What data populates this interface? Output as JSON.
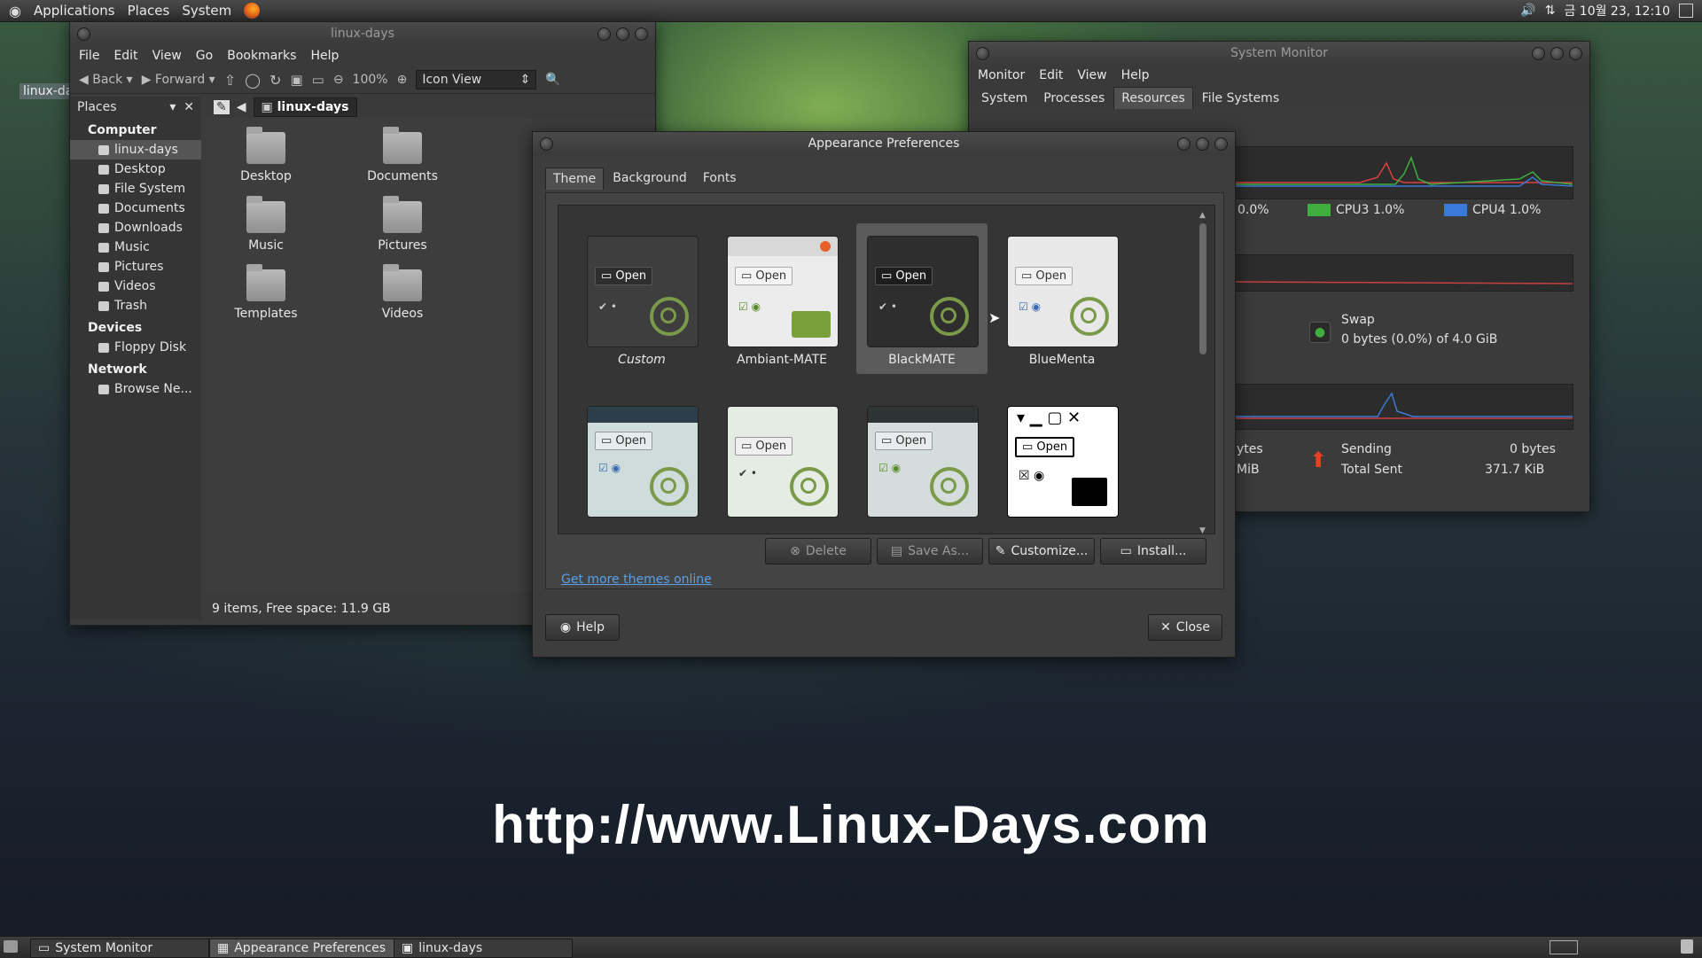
{
  "top_panel": {
    "menus": [
      "Applications",
      "Places",
      "System"
    ],
    "clock": "금 10월 23, 12:10"
  },
  "file_manager": {
    "title": "linux-days",
    "menus": [
      "File",
      "Edit",
      "View",
      "Go",
      "Bookmarks",
      "Help"
    ],
    "toolbar": {
      "back": "Back",
      "forward": "Forward",
      "zoom": "100%",
      "view_mode": "Icon View"
    },
    "sidebar_title": "Places",
    "sections": [
      {
        "label": "Computer",
        "items": [
          "linux-days",
          "Desktop",
          "File System",
          "Documents",
          "Downloads",
          "Music",
          "Pictures",
          "Videos",
          "Trash"
        ]
      },
      {
        "label": "Devices",
        "items": [
          "Floppy Disk"
        ]
      },
      {
        "label": "Network",
        "items": [
          "Browse Ne..."
        ]
      }
    ],
    "path": "linux-days",
    "files": [
      "Desktop",
      "Documents",
      "Music",
      "Pictures",
      "Templates",
      "Videos"
    ],
    "status": "9 items, Free space: 11.9 GB",
    "tab_label": "linux-da"
  },
  "system_monitor": {
    "title": "System Monitor",
    "menus": [
      "Monitor",
      "Edit",
      "View",
      "Help"
    ],
    "tabs": [
      "System",
      "Processes",
      "Resources",
      "File Systems"
    ],
    "cpu": [
      {
        "label": "0.0%"
      },
      {
        "label": "CPU3 1.0%",
        "color": "#3fae3f"
      },
      {
        "label": "CPU4 1.0%",
        "color": "#3a7ad8"
      }
    ],
    "swap": {
      "title": "Swap",
      "value": "0 bytes (0.0%) of 4.0 GiB"
    },
    "net": {
      "recv_partial": "ytes",
      "recv_total_partial": "MiB",
      "sending_label": "Sending",
      "sending_value": "0 bytes",
      "total_sent_label": "Total Sent",
      "total_sent_value": "371.7 KiB"
    }
  },
  "appearance": {
    "title": "Appearance Preferences",
    "tabs": [
      "Theme",
      "Background",
      "Fonts"
    ],
    "themes": [
      "Custom",
      "Ambiant-MATE",
      "BlackMATE",
      "BlueMenta"
    ],
    "open_label": "Open",
    "buttons": {
      "delete": "Delete",
      "save_as": "Save As...",
      "customize": "Customize...",
      "install": "Install..."
    },
    "link": "Get more themes online",
    "help": "Help",
    "close": "Close"
  },
  "taskbar": [
    "System Monitor",
    "Appearance Preferences",
    "linux-days"
  ],
  "watermark": "http://www.Linux-Days.com"
}
